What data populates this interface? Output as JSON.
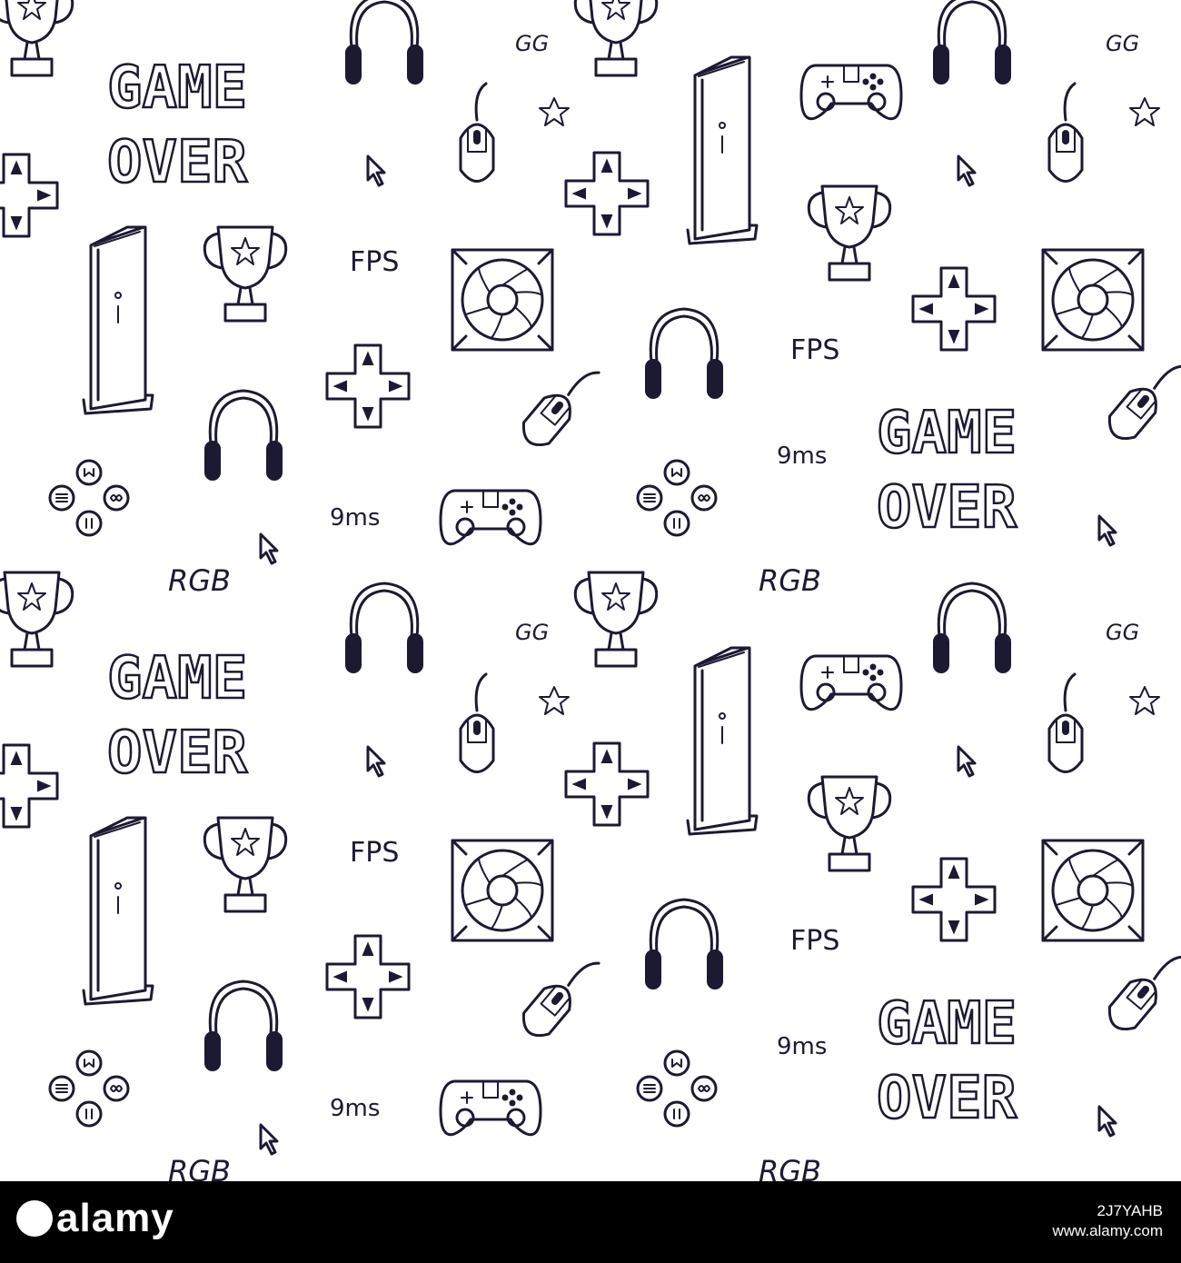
{
  "labels": {
    "game": "GAME",
    "over": "OVER",
    "fps": "FPS",
    "gg": "GG",
    "ms": "9ms",
    "rgb": "RGB"
  },
  "ink_color": "#1c1a33",
  "icons": [
    "trophy-icon",
    "headphones-icon",
    "console-tower-icon",
    "dpad-icon",
    "gamepad-icon",
    "mouse-icon",
    "cooling-fan-icon",
    "cursor-arrow-icon",
    "star-icon",
    "action-buttons-icon"
  ],
  "stock_bar": {
    "logo": "alamy",
    "image_id": "2J7YAHB",
    "site": "www.alamy.com"
  }
}
